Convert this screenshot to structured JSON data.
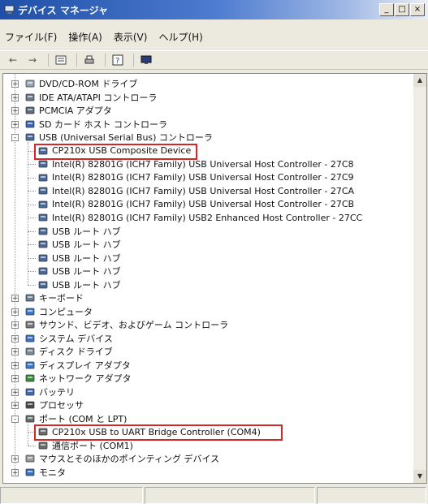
{
  "window": {
    "title": "デバイス マネージャ",
    "min": "_",
    "max": "□",
    "close": "×"
  },
  "menu": [
    "ファイル(F)",
    "操作(A)",
    "表示(V)",
    "ヘルプ(H)"
  ],
  "toolbar": {
    "back": "←",
    "forward": "→"
  },
  "tree": [
    {
      "label": "DVD/CD-ROM ドライブ",
      "level": 0,
      "exp": "+",
      "icon": "dvd-icon"
    },
    {
      "label": "IDE ATA/ATAPI コントローラ",
      "level": 0,
      "exp": "+",
      "icon": "ide-icon"
    },
    {
      "label": "PCMCIA アダプタ",
      "level": 0,
      "exp": "+",
      "icon": "pcmcia-icon"
    },
    {
      "label": "SD カード ホスト コントローラ",
      "level": 0,
      "exp": "+",
      "icon": "sd-icon"
    },
    {
      "label": "USB (Universal Serial Bus) コントローラ",
      "level": 0,
      "exp": "-",
      "icon": "usb-icon"
    },
    {
      "label": "CP210x USB Composite Device",
      "level": 1,
      "icon": "usb-icon",
      "highlight": true
    },
    {
      "label": "Intel(R) 82801G (ICH7 Family) USB Universal Host Controller - 27C8",
      "level": 1,
      "icon": "usb-icon"
    },
    {
      "label": "Intel(R) 82801G (ICH7 Family) USB Universal Host Controller - 27C9",
      "level": 1,
      "icon": "usb-icon"
    },
    {
      "label": "Intel(R) 82801G (ICH7 Family) USB Universal Host Controller - 27CA",
      "level": 1,
      "icon": "usb-icon"
    },
    {
      "label": "Intel(R) 82801G (ICH7 Family) USB Universal Host Controller - 27CB",
      "level": 1,
      "icon": "usb-icon"
    },
    {
      "label": "Intel(R) 82801G (ICH7 Family) USB2 Enhanced Host Controller - 27CC",
      "level": 1,
      "icon": "usb-icon"
    },
    {
      "label": "USB ルート ハブ",
      "level": 1,
      "icon": "usb-icon"
    },
    {
      "label": "USB ルート ハブ",
      "level": 1,
      "icon": "usb-icon"
    },
    {
      "label": "USB ルート ハブ",
      "level": 1,
      "icon": "usb-icon"
    },
    {
      "label": "USB ルート ハブ",
      "level": 1,
      "icon": "usb-icon"
    },
    {
      "label": "USB ルート ハブ",
      "level": 1,
      "icon": "usb-icon"
    },
    {
      "label": "キーボード",
      "level": 0,
      "exp": "+",
      "icon": "keyboard-icon"
    },
    {
      "label": "コンピュータ",
      "level": 0,
      "exp": "+",
      "icon": "computer-icon"
    },
    {
      "label": "サウンド、ビデオ、およびゲーム コントローラ",
      "level": 0,
      "exp": "+",
      "icon": "sound-icon"
    },
    {
      "label": "システム デバイス",
      "level": 0,
      "exp": "+",
      "icon": "system-icon"
    },
    {
      "label": "ディスク ドライブ",
      "level": 0,
      "exp": "+",
      "icon": "disk-icon"
    },
    {
      "label": "ディスプレイ アダプタ",
      "level": 0,
      "exp": "+",
      "icon": "display-icon"
    },
    {
      "label": "ネットワーク アダプタ",
      "level": 0,
      "exp": "+",
      "icon": "network-icon"
    },
    {
      "label": "バッテリ",
      "level": 0,
      "exp": "+",
      "icon": "battery-icon"
    },
    {
      "label": "プロセッサ",
      "level": 0,
      "exp": "+",
      "icon": "processor-icon"
    },
    {
      "label": "ポート (COM と LPT)",
      "level": 0,
      "exp": "-",
      "icon": "port-icon"
    },
    {
      "label": "CP210x USB to UART Bridge Controller (COM4)",
      "level": 1,
      "icon": "port-icon",
      "highlight": true
    },
    {
      "label": "通信ポート (COM1)",
      "level": 1,
      "icon": "port-icon"
    },
    {
      "label": "マウスとそのほかのポインティング デバイス",
      "level": 0,
      "exp": "+",
      "icon": "mouse-icon"
    },
    {
      "label": "モニタ",
      "level": 0,
      "exp": "+",
      "icon": "monitor-icon"
    }
  ],
  "colors": {
    "highlight": "#d42828",
    "title_bar": "#1f4fa8"
  }
}
